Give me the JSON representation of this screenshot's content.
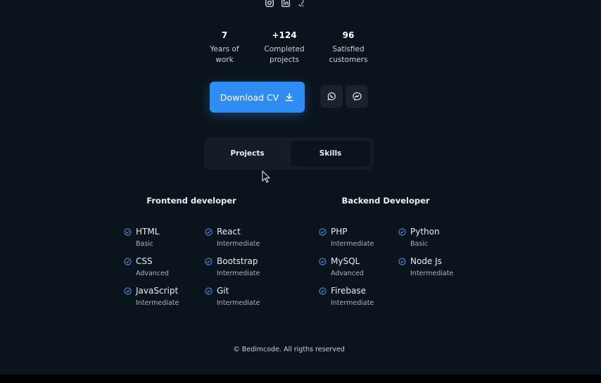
{
  "social": {
    "icons": [
      "instagram-icon",
      "linkedin-icon",
      "github-icon"
    ]
  },
  "stats": [
    {
      "value": "7",
      "label_line1": "Years of",
      "label_line2": "work"
    },
    {
      "value": "+124",
      "label_line1": "Completed",
      "label_line2": "projects"
    },
    {
      "value": "96",
      "label_line1": "Satisfied",
      "label_line2": "customers"
    }
  ],
  "cta": {
    "download_label": "Download CV",
    "download_icon": "download-icon",
    "whatsapp_icon": "whatsapp-icon",
    "messenger_icon": "messenger-icon"
  },
  "tabs": [
    {
      "label": "Projects",
      "active": false
    },
    {
      "label": "Skills",
      "active": true
    }
  ],
  "skills": {
    "frontend": {
      "title": "Frontend developer",
      "items": [
        {
          "name": "HTML",
          "level": "Basic"
        },
        {
          "name": "React",
          "level": "Intermediate"
        },
        {
          "name": "CSS",
          "level": "Advanced"
        },
        {
          "name": "Bootstrap",
          "level": "Intermediate"
        },
        {
          "name": "JavaScript",
          "level": "Intermediate"
        },
        {
          "name": "Git",
          "level": "Intermediate"
        }
      ]
    },
    "backend": {
      "title": "Backend Developer",
      "items": [
        {
          "name": "PHP",
          "level": "Intermediate"
        },
        {
          "name": "Python",
          "level": "Basic"
        },
        {
          "name": "MySQL",
          "level": "Advanced"
        },
        {
          "name": "Node Js",
          "level": "Intermediate"
        },
        {
          "name": "Firebase",
          "level": "Intermediate"
        }
      ]
    }
  },
  "footer": {
    "text": "© Bedimcode. All rigths reserved"
  },
  "colors": {
    "background": "#0b141c",
    "accent": "#2f8cf2",
    "surface": "#141d26",
    "check": "#4a90e2"
  }
}
